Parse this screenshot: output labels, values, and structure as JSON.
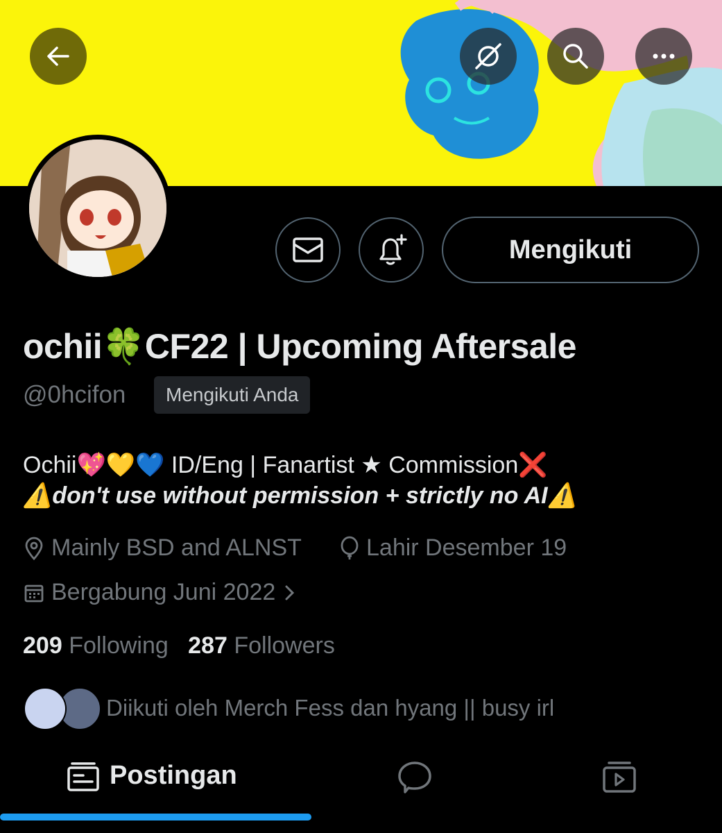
{
  "header": {
    "back_icon": "arrow-left-icon",
    "actions": [
      "grok-icon",
      "search-icon",
      "more-icon"
    ]
  },
  "profile": {
    "display_name": "ochii🍀CF22 | Upcoming Aftersale",
    "handle": "@0hcifon",
    "follows_you_badge": "Mengikuti Anda",
    "follow_button_label": "Mengikuti",
    "bio_line1": "Ochii💖💛💙 ID/Eng | Fanartist ★ Commission❌",
    "bio_line2": "⚠️don't use without permission + strictly no AI⚠️",
    "location": "Mainly BSD and ALNST",
    "birthday": "Lahir Desember 19",
    "joined": "Bergabung Juni 2022",
    "following_count": "209",
    "following_label": "Following",
    "followers_count": "287",
    "followers_label": "Followers",
    "followed_by": "Diikuti oleh Merch Fess dan hyang || busy irl"
  },
  "tabs": {
    "active_label": "Postingan"
  },
  "colors": {
    "banner": "#fbf40a",
    "accent": "#1d9bf0",
    "muted": "#71767b"
  }
}
